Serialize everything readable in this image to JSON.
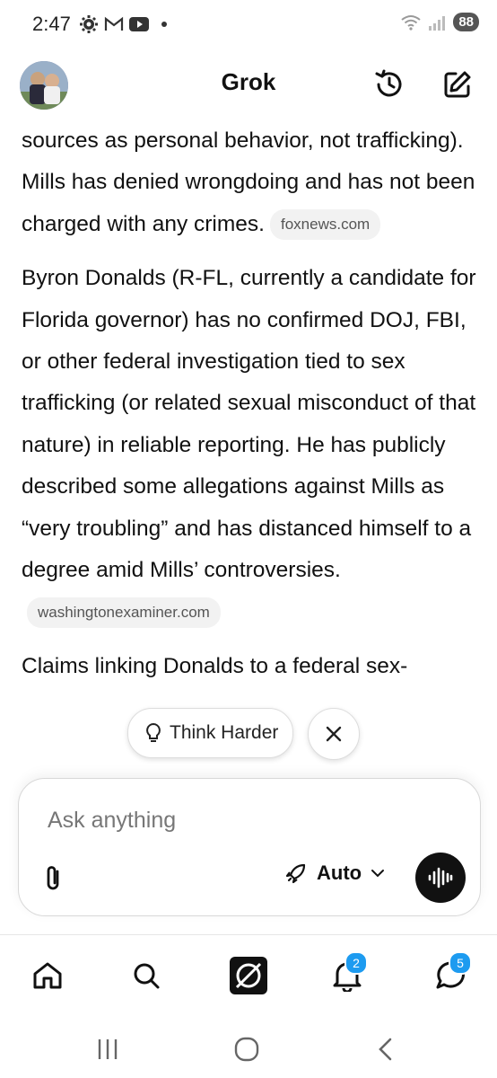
{
  "status": {
    "time": "2:47",
    "battery": "88"
  },
  "header": {
    "title": "Grok"
  },
  "content": {
    "p1": "sources as personal behavior, not trafficking). Mills has denied wrongdoing and has not been charged with any crimes.",
    "p1_source": "foxnews.com",
    "p2": "Byron Donalds (R-FL, currently a candidate for Florida governor) has no confirmed DOJ, FBI, or other federal investigation tied to sex trafficking (or related sexual misconduct of that nature) in reliable reporting. He has publicly described some allegations against Mills as “very troubling” and has distanced himself to a degree amid Mills’ controversies.",
    "p2_source": "washingtonexaminer.com",
    "p3": "Claims linking Donalds to a federal sex-"
  },
  "suggestion": {
    "label": "Think Harder"
  },
  "composer": {
    "placeholder": "Ask anything",
    "mode": "Auto"
  },
  "nav": {
    "notifications_badge": "2",
    "messages_badge": "5"
  },
  "colors": {
    "accent": "#1d9bf0",
    "text": "#111111",
    "chip_bg": "#f2f2f2"
  }
}
